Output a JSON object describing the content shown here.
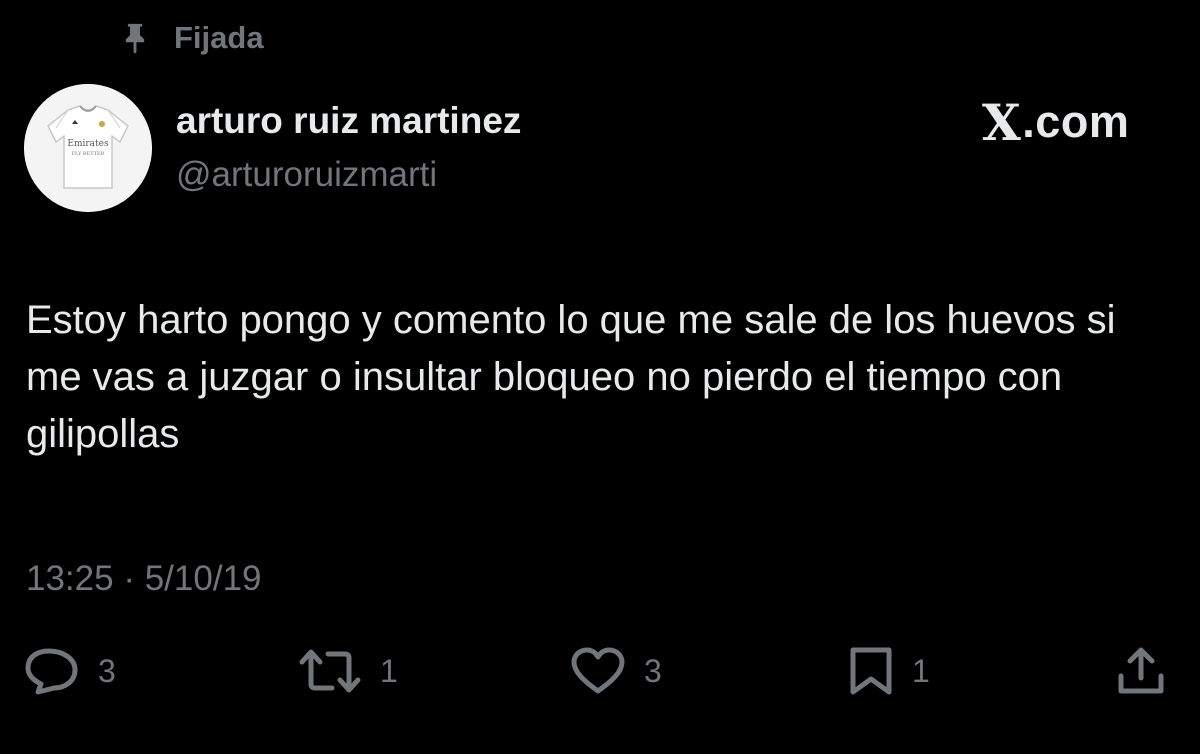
{
  "pinned": {
    "label": "Fijada",
    "icon": "pin-icon"
  },
  "user": {
    "name": "arturo ruiz martinez",
    "handle": "@arturoruizmarti",
    "avatar_shirt_text": [
      "Emirates",
      "FLY BETTER"
    ]
  },
  "brand": {
    "x": "X",
    "domain": ".com"
  },
  "tweet": {
    "text": "Estoy harto pongo y comento lo que me sale de los huevos si me vas a juzgar o insultar bloqueo no pierdo el tiempo con gilipollas",
    "time": "13:25",
    "separator": "·",
    "date": "5/10/19"
  },
  "actions": {
    "replies": "3",
    "retweets": "1",
    "likes": "3",
    "bookmarks": "1"
  },
  "colors": {
    "background": "#000000",
    "primary_text": "#e7e9ea",
    "secondary_text": "#71767b"
  }
}
